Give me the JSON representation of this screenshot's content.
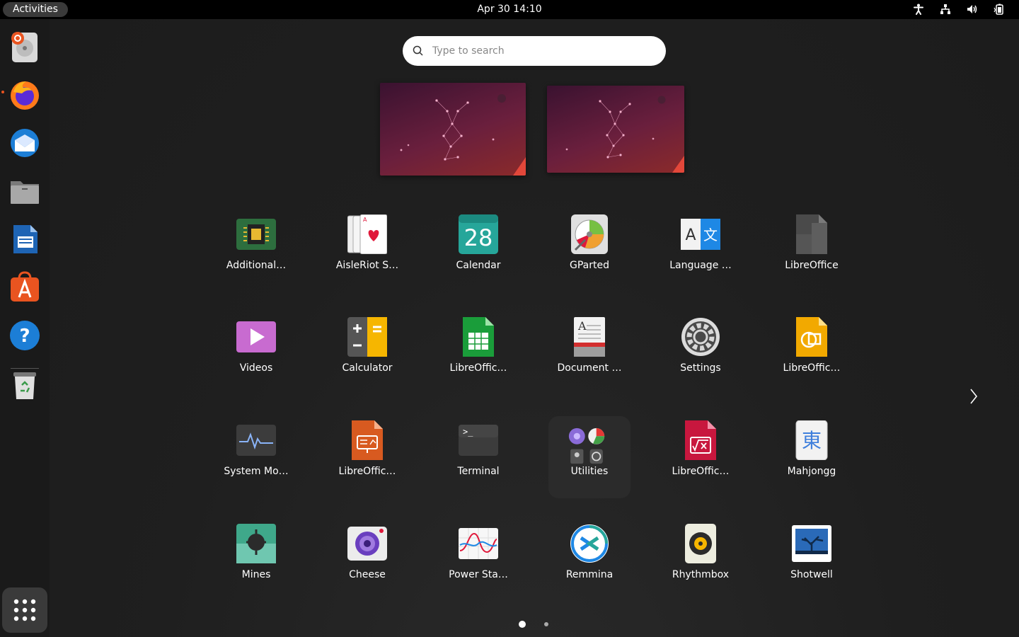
{
  "topbar": {
    "activities_label": "Activities",
    "clock": "Apr 30  14:10",
    "tray": [
      "accessibility-icon",
      "network-icon",
      "volume-icon",
      "battery-icon"
    ]
  },
  "dock": {
    "items": [
      {
        "name": "ubuntu-installer"
      },
      {
        "name": "firefox"
      },
      {
        "name": "thunderbird"
      },
      {
        "name": "files"
      },
      {
        "name": "libreoffice-writer"
      },
      {
        "name": "ubuntu-software"
      },
      {
        "name": "help"
      },
      {
        "name": "trash"
      }
    ],
    "show_apps": "show-applications"
  },
  "search": {
    "placeholder": "Type to search"
  },
  "apps": [
    {
      "label": "Additional…",
      "icon": "additional-drivers-icon"
    },
    {
      "label": "AisleRiot S…",
      "icon": "aisleriot-icon"
    },
    {
      "label": "Calendar",
      "icon": "calendar-icon",
      "number": "28"
    },
    {
      "label": "GParted",
      "icon": "gparted-icon"
    },
    {
      "label": "Language …",
      "icon": "language-support-icon",
      "glyphs": "A 文"
    },
    {
      "label": "LibreOffice",
      "icon": "libreoffice-icon"
    },
    {
      "label": "Videos",
      "icon": "videos-icon"
    },
    {
      "label": "Calculator",
      "icon": "calculator-icon"
    },
    {
      "label": "LibreOffic…",
      "icon": "libreoffice-calc-icon"
    },
    {
      "label": "Document …",
      "icon": "document-viewer-icon"
    },
    {
      "label": "Settings",
      "icon": "settings-icon"
    },
    {
      "label": "LibreOffic…",
      "icon": "libreoffice-draw-icon"
    },
    {
      "label": "System Mo…",
      "icon": "system-monitor-icon"
    },
    {
      "label": "LibreOffic…",
      "icon": "libreoffice-impress-icon"
    },
    {
      "label": "Terminal",
      "icon": "terminal-icon"
    },
    {
      "label": "Utilities",
      "icon": "utilities-folder-icon"
    },
    {
      "label": "LibreOffic…",
      "icon": "libreoffice-math-icon"
    },
    {
      "label": "Mahjongg",
      "icon": "mahjongg-icon",
      "glyph": "東"
    },
    {
      "label": "Mines",
      "icon": "mines-icon"
    },
    {
      "label": "Cheese",
      "icon": "cheese-icon"
    },
    {
      "label": "Power Sta…",
      "icon": "power-statistics-icon"
    },
    {
      "label": "Remmina",
      "icon": "remmina-icon"
    },
    {
      "label": "Rhythmbox",
      "icon": "rhythmbox-icon"
    },
    {
      "label": "Shotwell",
      "icon": "shotwell-icon"
    }
  ],
  "pager": {
    "pages": 2,
    "current": 1
  },
  "colors": {
    "accent": "#e95420",
    "panel": "#000000",
    "dock": "#1a1a1a"
  }
}
